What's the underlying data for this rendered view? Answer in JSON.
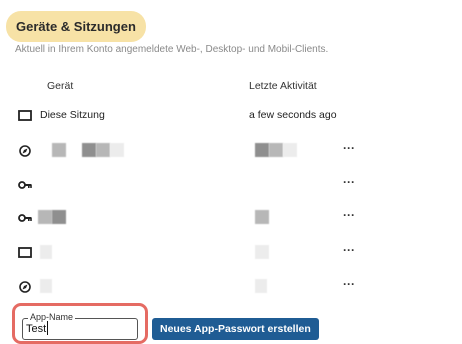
{
  "section": {
    "title": "Geräte & Sitzungen",
    "subtitle": "Aktuell in Ihrem Konto angemeldete Web-, Desktop- und Mobil-Clients."
  },
  "table": {
    "headers": {
      "device": "Gerät",
      "activity": "Letzte Aktivität"
    },
    "rows": [
      {
        "icon": "desktop-icon",
        "name": "Diese Sitzung",
        "activity": "a few seconds ago",
        "has_menu": false
      },
      {
        "icon": "compass-icon",
        "name": "",
        "activity": "",
        "has_menu": true
      },
      {
        "icon": "key-icon",
        "name": "",
        "activity": "",
        "has_menu": true
      },
      {
        "icon": "key-icon",
        "name": "",
        "activity": "",
        "has_menu": true
      },
      {
        "icon": "desktop-icon",
        "name": "",
        "activity": "",
        "has_menu": true
      },
      {
        "icon": "compass-icon",
        "name": "",
        "activity": "",
        "has_menu": true
      }
    ],
    "more_label": "···"
  },
  "app_password": {
    "field_label": "App-Name",
    "field_value": "Test",
    "create_button": "Neues App-Passwort erstellen"
  },
  "colors": {
    "title_pill": "#f7e2a6",
    "button": "#1f5c94",
    "highlight": "#e56b63"
  }
}
